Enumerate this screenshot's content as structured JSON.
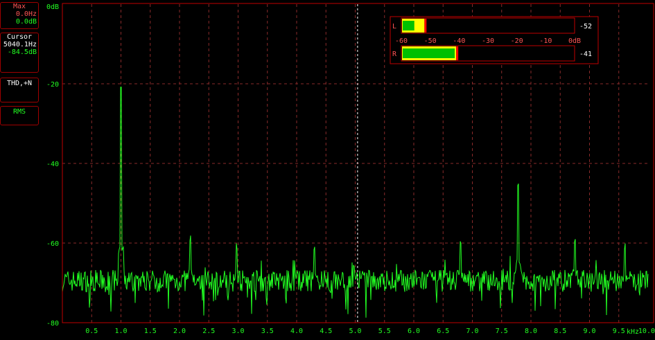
{
  "colors": {
    "background": "#000000",
    "grid": "#8a2a2a",
    "trace": "#22ff22",
    "frame": "#c00000",
    "text_green": "#22ff22",
    "text_red": "#ff5555",
    "meter_bar": "#00c000",
    "meter_yellow": "#ffff00",
    "meter_peak": "#ff0000"
  },
  "side_panels": {
    "max": {
      "label": "Max",
      "freq": "0.0Hz",
      "level": "0.0dB"
    },
    "cursor": {
      "label": "Cursor",
      "freq": "5040.1Hz",
      "level": "-84.5dB"
    },
    "thd": {
      "label": "THD,+N"
    },
    "rms": {
      "label": "RMS"
    }
  },
  "meters": {
    "left": {
      "label": "L",
      "value_text": "-52",
      "level_db": -55.5,
      "peak_db": -52
    },
    "right": {
      "label": "R",
      "value_text": "-41",
      "level_db": -41.5,
      "peak_db": -41
    },
    "scale_labels": [
      "-60",
      "-50",
      "-40",
      "-30",
      "-20",
      "-10",
      "0dB"
    ]
  },
  "chart_data": {
    "type": "line",
    "title": "",
    "xlabel": "kHz",
    "ylabel": "dB",
    "x_unit": "kHz",
    "y_unit": "dB",
    "xlim": [
      0,
      10
    ],
    "ylim": [
      -80,
      0
    ],
    "grid": true,
    "cursor_x": 5.04,
    "x_ticks": [
      "0.5",
      "1.0",
      "1.5",
      "2.0",
      "2.5",
      "3.0",
      "3.5",
      "4.0",
      "4.5",
      "5.0",
      "5.5",
      "6.0",
      "6.5",
      "7.0",
      "7.5",
      "8.0",
      "8.5",
      "9.0",
      "9.5",
      "10.0"
    ],
    "y_ticks": [
      "0dB",
      "-20",
      "-40",
      "-60",
      "-80"
    ],
    "noise_floor_db": -69.5,
    "peaks": [
      {
        "x": 1.0,
        "y": -22.0
      },
      {
        "x": 2.18,
        "y": -60.0
      },
      {
        "x": 2.98,
        "y": -62.0
      },
      {
        "x": 4.3,
        "y": -62.5
      },
      {
        "x": 6.8,
        "y": -61.0
      },
      {
        "x": 7.78,
        "y": -46.5
      },
      {
        "x": 8.75,
        "y": -60.5
      },
      {
        "x": 9.6,
        "y": -62.0
      }
    ]
  }
}
